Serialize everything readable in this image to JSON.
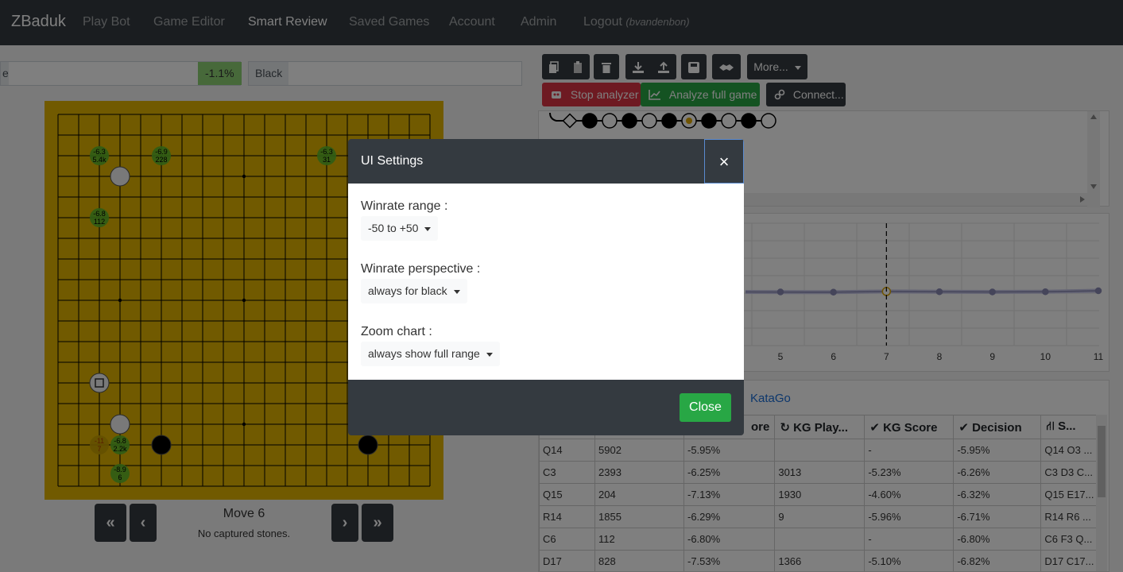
{
  "navbar": {
    "brand": "ZBaduk",
    "links": [
      "Play Bot",
      "Game Editor",
      "Smart Review",
      "Saved Games",
      "Account",
      "Admin"
    ],
    "logout": "Logout",
    "username": "(bvandenbon)"
  },
  "players": {
    "white_label_fragment": "e",
    "winrate": "-1.1%",
    "black_label": "Black"
  },
  "board": {
    "move_label": "Move 6",
    "captured": "No captured stones.",
    "annotations": [
      {
        "l1": "-6.3",
        "l2": "5.4k"
      },
      {
        "l1": "-6.9",
        "l2": "228"
      },
      {
        "l1": "-6.3",
        "l2": "31"
      },
      {
        "l1": "-6.8",
        "l2": "112"
      },
      {
        "l1": "-11",
        "l2": "7"
      },
      {
        "l1": "-6.8",
        "l2": "2.2k"
      },
      {
        "l1": "-8.9",
        "l2": "6"
      }
    ]
  },
  "navigation": {
    "first": "«",
    "prev": "‹",
    "next": "›",
    "last": "»"
  },
  "toolbar": {
    "more": "More...",
    "stop_analyzer": "Stop analyzer",
    "analyze_full_game": "Analyze full game",
    "connect": "Connect..."
  },
  "chart_data": {
    "type": "line",
    "x": [
      5,
      6,
      7,
      8,
      9,
      10,
      11
    ],
    "x_ticks": [
      "5",
      "6",
      "7",
      "8",
      "9",
      "10",
      "11"
    ],
    "values": [
      -1.0,
      -1.2,
      -0.6,
      -0.8,
      -1.0,
      -0.8,
      0.0
    ],
    "current_move": 7,
    "grid": true
  },
  "analysis": {
    "tab_katago": "KataGo",
    "headers": [
      "",
      "",
      "ore",
      "KG Play...",
      "KG Score",
      "Decision",
      "S..."
    ],
    "rows": [
      [
        "Q14",
        "5902",
        "-5.95%",
        "",
        "-",
        "-5.95%",
        "Q14 O3 ..."
      ],
      [
        "C3",
        "2393",
        "-6.25%",
        "3013",
        "-5.23%",
        "-6.26%",
        "C3 D3 C..."
      ],
      [
        "Q15",
        "204",
        "-7.13%",
        "1930",
        "-4.60%",
        "-6.32%",
        "Q15 E17..."
      ],
      [
        "R14",
        "1855",
        "-6.29%",
        "9",
        "-5.96%",
        "-6.71%",
        "R14 R6 ..."
      ],
      [
        "C6",
        "112",
        "-6.80%",
        "",
        "-",
        "-6.80%",
        "C6 F3 Q..."
      ],
      [
        "D17",
        "828",
        "-7.53%",
        "1366",
        "-5.10%",
        "-6.82%",
        "D17 C17..."
      ]
    ]
  },
  "modal": {
    "title": "UI Settings",
    "close_x": "×",
    "winrate_range_label": "Winrate range :",
    "winrate_range_value": "-50 to +50",
    "winrate_perspective_label": "Winrate perspective :",
    "winrate_perspective_value": "always for black",
    "zoom_chart_label": "Zoom chart :",
    "zoom_chart_value": "always show full range",
    "close_button": "Close"
  },
  "colors": {
    "navbar": "#343a40",
    "board": "#e2b500",
    "winrate_green": "#8fd275",
    "stop_red": "#dc3545",
    "analyze_green": "#28a745",
    "link_blue": "#1a6ed8"
  }
}
